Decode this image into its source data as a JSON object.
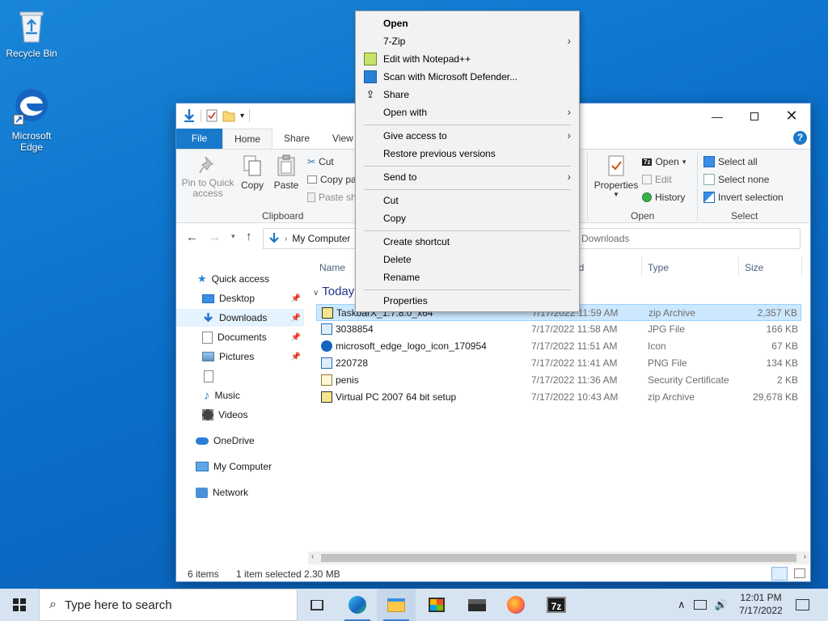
{
  "desktop": {
    "icons": [
      {
        "label": "Recycle Bin",
        "icon": "recycle-bin-icon"
      },
      {
        "label": "Microsoft Edge",
        "icon": "edge-icon"
      }
    ]
  },
  "explorer": {
    "ribbon_tabs": [
      "File",
      "Home",
      "Share",
      "View"
    ],
    "clipboard": {
      "pin_label": "Pin to Quick access",
      "copy_label": "Copy",
      "paste_label": "Paste",
      "cut_label": "Cut",
      "copy_path_label": "Copy pa",
      "paste_shortcut_label": "Paste sh",
      "group_label": "Clipboard"
    },
    "open_group": {
      "properties_label": "Properties",
      "open_label": "Open",
      "edit_label": "Edit",
      "history_label": "History",
      "group_label": "Open"
    },
    "select_group": {
      "select_all_label": "Select all",
      "select_none_label": "Select none",
      "invert_label": "Invert selection",
      "group_label": "Select"
    },
    "address": {
      "current": "My Computer"
    },
    "search": {
      "placeholder": "h Downloads"
    },
    "nav": [
      {
        "label": "Quick access",
        "icon": "star-icon"
      },
      {
        "label": "Desktop",
        "icon": "desktop-folder-icon",
        "pinned": true
      },
      {
        "label": "Downloads",
        "icon": "downloads-folder-icon",
        "pinned": true,
        "selected": true
      },
      {
        "label": "Documents",
        "icon": "documents-folder-icon",
        "pinned": true
      },
      {
        "label": "Pictures",
        "icon": "pictures-folder-icon",
        "pinned": true
      },
      {
        "label": "",
        "icon": "blank-file-icon"
      },
      {
        "label": "Music",
        "icon": "music-icon"
      },
      {
        "label": "Videos",
        "icon": "videos-icon"
      },
      {
        "label": "OneDrive",
        "icon": "cloud-icon"
      },
      {
        "label": "My Computer",
        "icon": "computer-icon"
      },
      {
        "label": "Network",
        "icon": "network-icon"
      }
    ],
    "columns": {
      "name": "Name",
      "date": "ed",
      "type": "Type",
      "size": "Size"
    },
    "group_title": "Today",
    "files": [
      {
        "name": "TaskbarX_1.7.8.0_x64",
        "date": "7/17/2022 11:59 AM",
        "type": "zip Archive",
        "size": "2,357 KB",
        "selected": true,
        "icon": "zip-icon"
      },
      {
        "name": "3038854",
        "date": "7/17/2022 11:58 AM",
        "type": "JPG File",
        "size": "166 KB",
        "icon": "image-file-icon"
      },
      {
        "name": "microsoft_edge_logo_icon_170954",
        "date": "7/17/2022 11:51 AM",
        "type": "Icon",
        "size": "67 KB",
        "icon": "edge-icon"
      },
      {
        "name": "220728",
        "date": "7/17/2022 11:41 AM",
        "type": "PNG File",
        "size": "134 KB",
        "icon": "image-file-icon"
      },
      {
        "name": "penis",
        "date": "7/17/2022 11:36 AM",
        "type": "Security Certificate",
        "size": "2 KB",
        "icon": "certificate-icon"
      },
      {
        "name": "Virtual PC 2007 64 bit setup",
        "date": "7/17/2022 10:43 AM",
        "type": "zip Archive",
        "size": "29,678 KB",
        "icon": "zip-icon"
      }
    ],
    "status": {
      "count": "6 items",
      "selection": "1 item selected",
      "size": "2.30 MB"
    }
  },
  "context_menu": {
    "items": [
      {
        "label": "Open",
        "bold": true
      },
      {
        "label": "7-Zip",
        "submenu": true
      },
      {
        "label": "Edit with Notepad++",
        "icon": "notepad-plus-icon"
      },
      {
        "label": "Scan with Microsoft Defender...",
        "icon": "defender-shield-icon"
      },
      {
        "label": "Share",
        "icon": "share-icon"
      },
      {
        "label": "Open with",
        "submenu": true
      },
      {
        "label": "Give access to",
        "submenu": true
      },
      {
        "label": "Restore previous versions"
      },
      {
        "label": "Send to",
        "submenu": true
      },
      {
        "label": "Cut"
      },
      {
        "label": "Copy"
      },
      {
        "label": "Create shortcut"
      },
      {
        "label": "Delete"
      },
      {
        "label": "Rename"
      },
      {
        "label": "Properties"
      }
    ]
  },
  "taskbar": {
    "search_placeholder": "Type here to search",
    "apps": [
      "task-view-icon",
      "edge-icon",
      "file-explorer-icon",
      "store-icon",
      "mail-icon",
      "firefox-icon",
      "7zip-icon"
    ],
    "time": "12:01 PM",
    "date": "7/17/2022"
  },
  "colors": {
    "accent": "#1979ca",
    "selection": "#cce8ff",
    "taskbar": "#d6e4f2"
  }
}
